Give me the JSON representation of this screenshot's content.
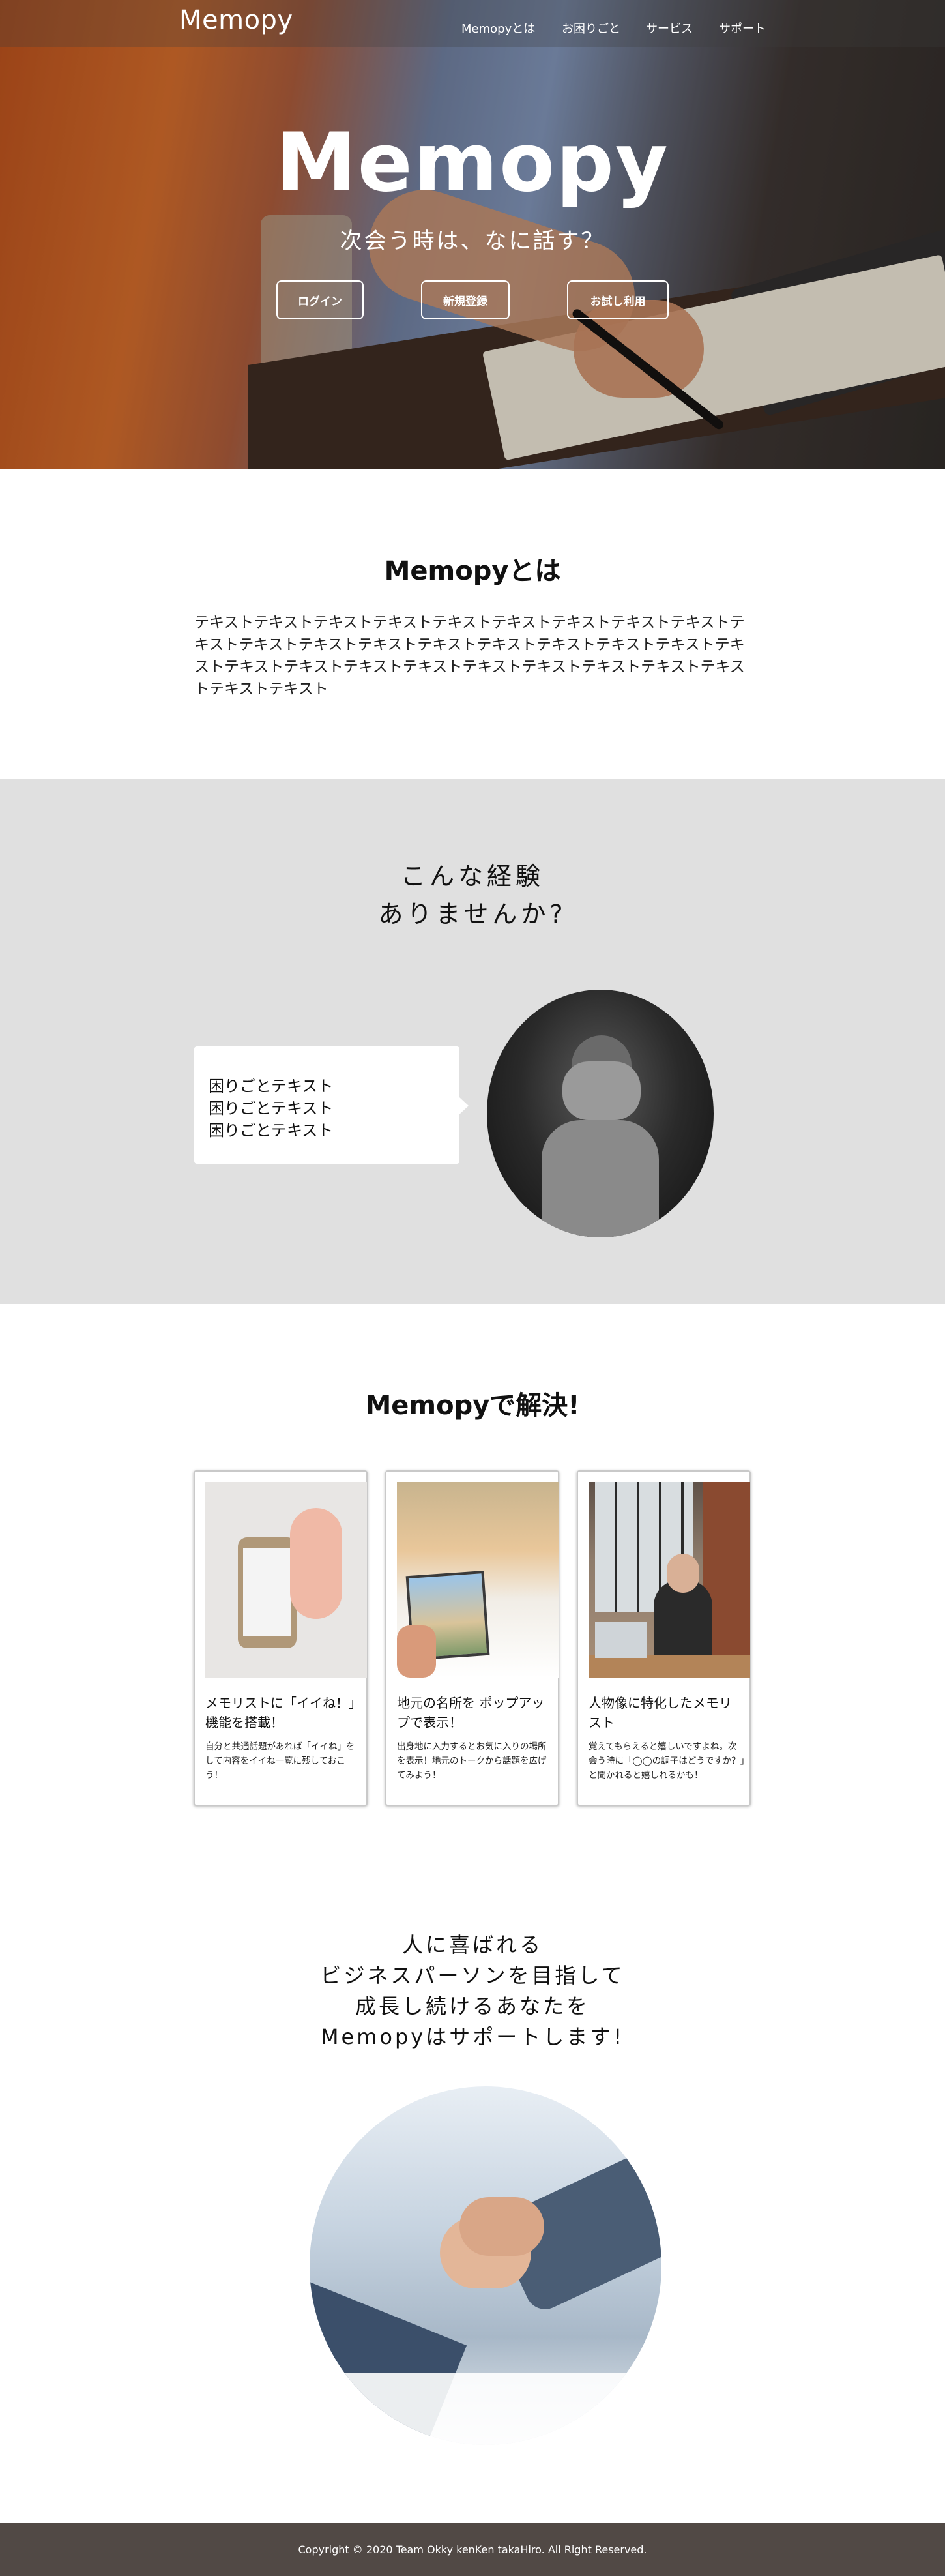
{
  "header": {
    "brand": "Memopy",
    "nav": [
      "Memopyとは",
      "お困りごと",
      "サービス",
      "サポート"
    ]
  },
  "hero": {
    "title": "Memopy",
    "subtitle": "次会う時は、なに話す？",
    "buttons": [
      "ログイン",
      "新規登録",
      "お試し利用"
    ]
  },
  "about": {
    "title": "Memopyとは",
    "text": "テキストテキストテキストテキストテキストテキストテキストテキストテキストテキストテキストテキストテキストテキストテキストテキストテキストテキストテキストテキストテキストテキストテキストテキストテキストテキストテキストテキストテキストテキスト"
  },
  "problem": {
    "title_line1": "こんな経験",
    "title_line2": "ありませんか?",
    "items": [
      "困りごとテキスト",
      "困りごとテキスト",
      "困りごとテキスト"
    ]
  },
  "solution": {
    "title": "Memopyで解決!",
    "cards": [
      {
        "title": "メモリストに「イイね！」機能を搭載！",
        "text": "自分と共通話題があれば「イイね」をして内容をイイね一覧に残しておこう！",
        "icon": "thumbs-up-phone-image"
      },
      {
        "title": "地元の名所を ポップアップで表示！",
        "text": "出身地に入力するとお気に入りの場所を表示！地元のトークから話題を広げてみよう！",
        "icon": "landmark-photo-image"
      },
      {
        "title": "人物像に特化したメモリスト",
        "text": "覚えてもらえると嬉しいですよね。次会う時に「◯◯の調子はどうですか？」と聞かれると嬉しれるかも！",
        "icon": "cafe-person-image"
      }
    ]
  },
  "cta": {
    "lines": [
      "人に喜ばれる",
      "ビジネスパーソンを目指して",
      "成長し続けるあなたを",
      "Memopyはサポートします!"
    ]
  },
  "footer": {
    "copyright": "Copyright © 2020 Team Okky kenKen takaHiro. All Right Reserved."
  },
  "colors": {
    "footer_bg": "#514945",
    "problem_bg": "#e0e0e0"
  }
}
